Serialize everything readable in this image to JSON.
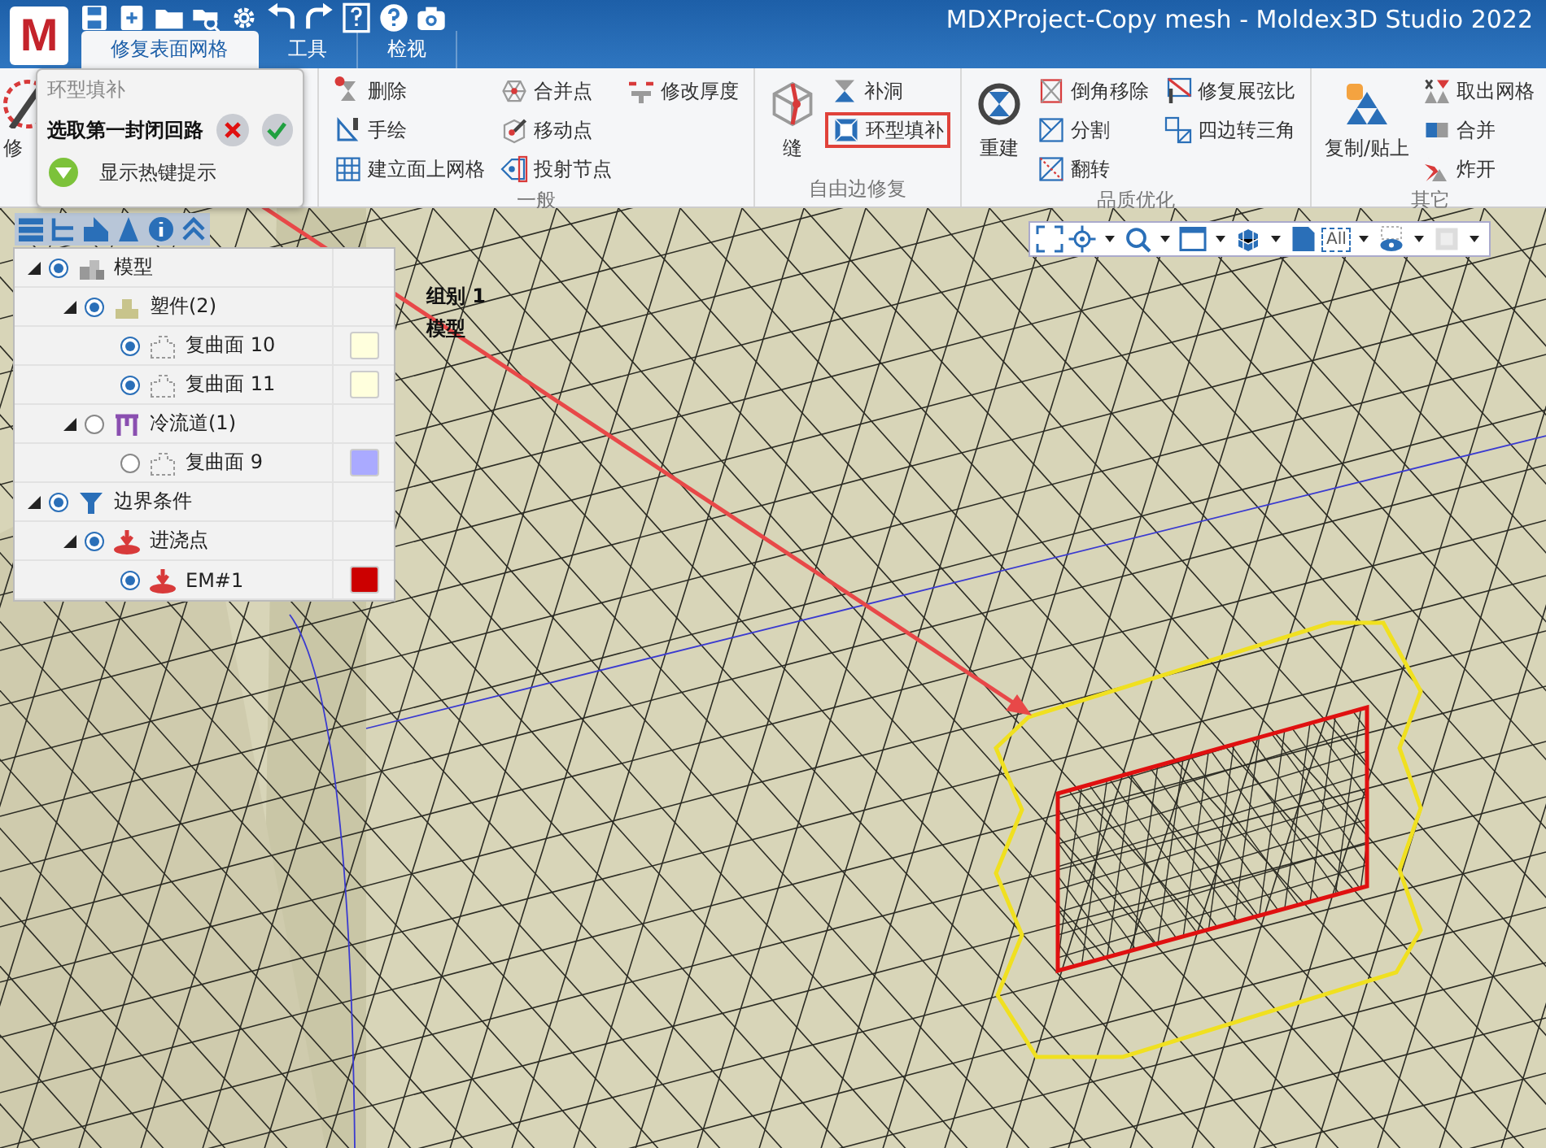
{
  "window": {
    "title": "MDXProject-Copy mesh - Moldex3D Studio 2022",
    "logo": "M"
  },
  "tabs": [
    {
      "label": "修复表面网格",
      "selected": true
    },
    {
      "label": "工具",
      "selected": false
    },
    {
      "label": "检视",
      "selected": false
    }
  ],
  "ribbon": {
    "groups": [
      {
        "columns": [
          [
            {
              "label": "修",
              "kind": "large",
              "highlighted": false
            }
          ]
        ]
      },
      {
        "label": "一般",
        "columns": [
          [
            {
              "label": "删除",
              "kind": "small",
              "highlighted": false
            },
            {
              "label": "手绘",
              "kind": "small",
              "highlighted": false
            },
            {
              "label": "建立面上网格",
              "kind": "small",
              "highlighted": false
            }
          ],
          [
            {
              "label": "合并点",
              "kind": "small",
              "highlighted": false
            },
            {
              "label": "移动点",
              "kind": "small",
              "highlighted": false
            },
            {
              "label": "投射节点",
              "kind": "small",
              "highlighted": false
            }
          ],
          [
            {
              "label": "修改厚度",
              "kind": "small",
              "highlighted": false
            }
          ]
        ]
      },
      {
        "label": "自由边修复",
        "columns": [
          [
            {
              "label": "缝",
              "kind": "large",
              "highlighted": false
            }
          ],
          [
            {
              "label": "补洞",
              "kind": "small",
              "highlighted": false
            },
            {
              "label": "环型填补",
              "kind": "small",
              "highlighted": true
            }
          ]
        ]
      },
      {
        "label": "品质优化",
        "columns": [
          [
            {
              "label": "重建",
              "kind": "large",
              "highlighted": false
            }
          ],
          [
            {
              "label": "倒角移除",
              "kind": "small",
              "highlighted": false
            },
            {
              "label": "分割",
              "kind": "small",
              "highlighted": false
            },
            {
              "label": "翻转",
              "kind": "small",
              "highlighted": false
            }
          ],
          [
            {
              "label": "修复展弦比",
              "kind": "small",
              "highlighted": false
            },
            {
              "label": "四边转三角",
              "kind": "small",
              "highlighted": false
            }
          ]
        ]
      },
      {
        "label": "其它",
        "columns": [
          [
            {
              "label": "复制/贴上",
              "kind": "large",
              "highlighted": false
            }
          ],
          [
            {
              "label": "取出网格",
              "kind": "small",
              "highlighted": false
            },
            {
              "label": "合并",
              "kind": "small",
              "highlighted": false
            },
            {
              "label": "炸开",
              "kind": "small",
              "highlighted": false
            }
          ]
        ]
      }
    ]
  },
  "popup": {
    "title": "环型填补",
    "prompt": "选取第一封闭回路",
    "hotkey_label": "显示热键提示"
  },
  "tree": [
    {
      "label": "模型",
      "kind": "model",
      "visible": true,
      "children": [
        {
          "label": "塑件(2)",
          "kind": "part",
          "visible": true,
          "children": [
            {
              "label": "复曲面 10",
              "kind": "surface",
              "visible": true,
              "color": "#ffffdd"
            },
            {
              "label": "复曲面 11",
              "kind": "surface",
              "visible": true,
              "color": "#ffffdd"
            }
          ]
        },
        {
          "label": "冷流道(1)",
          "kind": "runner",
          "visible": false,
          "children": [
            {
              "label": "复曲面 9",
              "kind": "surface",
              "visible": false,
              "color": "#aaaaff"
            }
          ]
        }
      ]
    },
    {
      "label": "边界条件",
      "kind": "boundary",
      "visible": true,
      "children": [
        {
          "label": "进浇点",
          "kind": "gate",
          "visible": true,
          "children": [
            {
              "label": "EM#1",
              "kind": "gate",
              "visible": true,
              "color": "#cc0000"
            }
          ]
        }
      ]
    }
  ],
  "view_toolbar": {
    "filter_label": "All"
  },
  "viewport_labels": [
    "组别 1",
    "模型"
  ]
}
